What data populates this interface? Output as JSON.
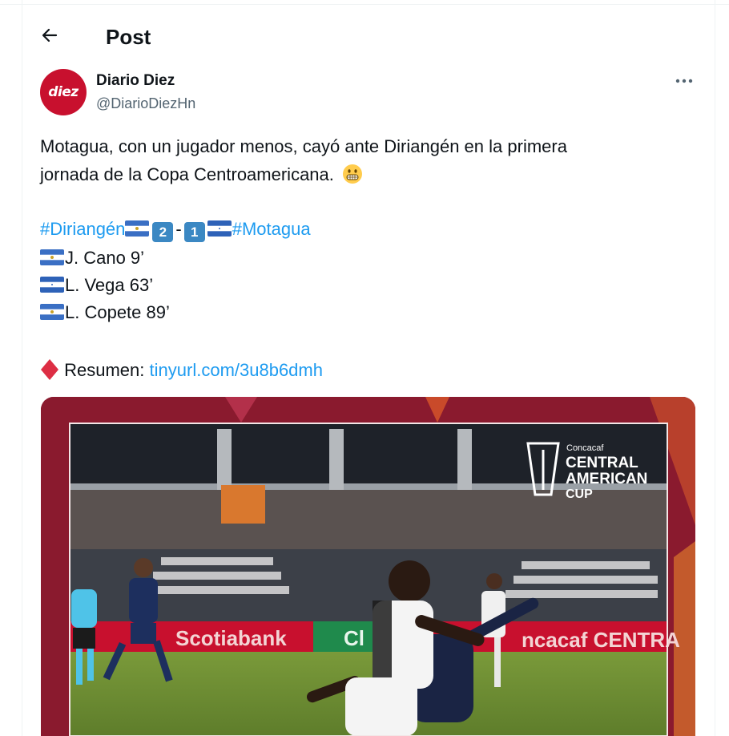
{
  "header": {
    "title": "Post"
  },
  "author": {
    "name": "Diario Diez",
    "handle": "@DiarioDiezHn",
    "avatar_text": "diez"
  },
  "tweet": {
    "line1": "Motagua, con un jugador menos, cayó ante Diriangén en la primera",
    "line2": "jornada de la Copa Centroamericana.",
    "score": {
      "team1_tag": "#Diriangén",
      "score1": "2",
      "separator": "-",
      "score2": "1",
      "team2_tag": "#Motagua"
    },
    "goals": [
      "J. Cano 9’",
      "L. Vega 63’",
      "L. Copete 89’"
    ],
    "summary_label": "Resumen:",
    "summary_link": "tinyurl.com/3u8b6dmh"
  },
  "media": {
    "brand_small": "Concacaf",
    "brand_line1": "CENTRAL",
    "brand_line2": "AMERICAN",
    "brand_line3": "CUP",
    "ad_board_1": "Scotiabank",
    "ad_board_2": "Cl",
    "ad_board_3": "ncacaf CENTRA"
  },
  "icons": {
    "back": "arrow-left-icon",
    "more": "more-dots-icon",
    "emoji": "grimacing-face-icon",
    "bullet": "red-diamond-icon"
  },
  "colors": {
    "link": "#1d9bf0",
    "brand_red": "#c8102e",
    "frame": "#8a1a2e"
  }
}
